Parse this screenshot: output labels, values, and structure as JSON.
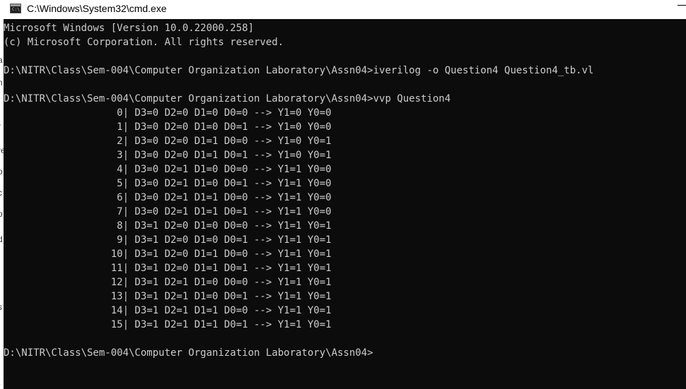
{
  "window": {
    "title": "C:\\Windows\\System32\\cmd.exe",
    "icon_label": "C:\\"
  },
  "console": {
    "lines": [
      "Microsoft Windows [Version 10.0.22000.258]",
      "(c) Microsoft Corporation. All rights reserved.",
      "",
      "D:\\NITR\\Class\\Sem-004\\Computer Organization Laboratory\\Assn04>iverilog -o Question4 Question4_tb.vl",
      "",
      "D:\\NITR\\Class\\Sem-004\\Computer Organization Laboratory\\Assn04>vvp Question4",
      "                   0| D3=0 D2=0 D1=0 D0=0 --> Y1=0 Y0=0",
      "                   1| D3=0 D2=0 D1=0 D0=1 --> Y1=0 Y0=0",
      "                   2| D3=0 D2=0 D1=1 D0=0 --> Y1=0 Y0=1",
      "                   3| D3=0 D2=0 D1=1 D0=1 --> Y1=0 Y0=1",
      "                   4| D3=0 D2=1 D1=0 D0=0 --> Y1=1 Y0=0",
      "                   5| D3=0 D2=1 D1=0 D0=1 --> Y1=1 Y0=0",
      "                   6| D3=0 D2=1 D1=1 D0=0 --> Y1=1 Y0=0",
      "                   7| D3=0 D2=1 D1=1 D0=1 --> Y1=1 Y0=0",
      "                   8| D3=1 D2=0 D1=0 D0=0 --> Y1=1 Y0=1",
      "                   9| D3=1 D2=0 D1=0 D0=1 --> Y1=1 Y0=1",
      "                  10| D3=1 D2=0 D1=1 D0=0 --> Y1=1 Y0=1",
      "                  11| D3=1 D2=0 D1=1 D0=1 --> Y1=1 Y0=1",
      "                  12| D3=1 D2=1 D1=0 D0=0 --> Y1=1 Y0=1",
      "                  13| D3=1 D2=1 D1=0 D0=1 --> Y1=1 Y0=1",
      "                  14| D3=1 D2=1 D1=1 D0=0 --> Y1=1 Y0=1",
      "                  15| D3=1 D2=1 D1=1 D0=1 --> Y1=1 Y0=1",
      "",
      "D:\\NITR\\Class\\Sem-004\\Computer Organization Laboratory\\Assn04>"
    ]
  },
  "background_window": {
    "edge_letters": [
      "a",
      "n",
      "r",
      "re",
      "o",
      "c",
      "o",
      "d",
      "s",
      "t"
    ]
  },
  "colors": {
    "console_bg": "#0c0c0c",
    "console_fg": "#cccccc",
    "titlebar_bg": "#ffffff"
  }
}
